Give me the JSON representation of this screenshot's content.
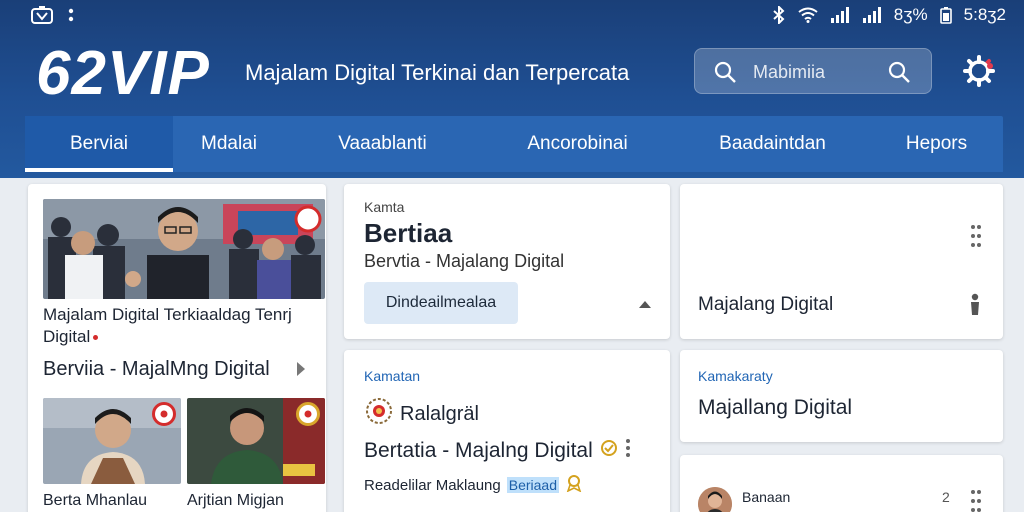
{
  "status_bar": {
    "left_icons": [
      "app-logo-icon",
      "dots-icon"
    ],
    "battery_text": "8ʒ%",
    "time": "5:8ʒ2"
  },
  "header": {
    "brand": "62VIP",
    "tagline": "Majalam Digital Terkinai dan Terpercata",
    "search_placeholder": "Mabimiia"
  },
  "nav": {
    "tabs": [
      {
        "label": "Berviai",
        "active": true
      },
      {
        "label": "Mdalai",
        "active": false
      },
      {
        "label": "Vaaablanti",
        "active": false
      },
      {
        "label": "Ancorobinai",
        "active": false
      },
      {
        "label": "Baadaintdan",
        "active": false
      },
      {
        "label": "Hepors",
        "active": false
      }
    ]
  },
  "feature": {
    "title": "Majalam Digital Terkiaaldag Tenrj Digital",
    "subtitle": "Berviia - MajalMng Digital",
    "thumbs": [
      {
        "caption": "Berta Mhanlau"
      },
      {
        "caption": "Arjtian Migjan"
      }
    ]
  },
  "card_main": {
    "kicker": "Kamta",
    "title": "Bertiaa",
    "subtitle": "Bervtia  -  Majalang Digital",
    "dropdown_value": "Dindeailmealaa"
  },
  "card_right_top": {
    "label": "Majalang Digital"
  },
  "card_mid_bottom": {
    "kicker": "Kamatan",
    "row_label": "Ralalgräl",
    "title": "Bertatia - Majalng Digital",
    "footer_text": "Readelilar Maklaung",
    "footer_tag": "Beriaad"
  },
  "card_right_mid": {
    "kicker": "Kamakaraty",
    "title": "Majallang Digital"
  },
  "card_right_bottom": {
    "label": "Banaan",
    "count": "2"
  },
  "colors": {
    "header_blue": "#1f4f93",
    "nav_blue": "#2a66b3",
    "accent_red": "#d42c2c",
    "link_blue": "#2266b5"
  }
}
